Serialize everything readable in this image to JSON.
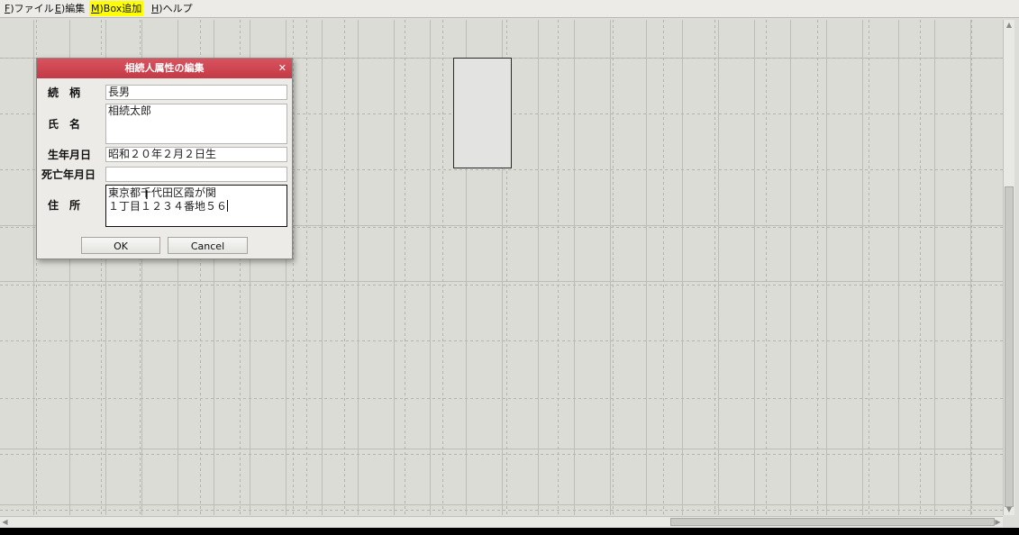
{
  "menu": [
    {
      "accel": "F",
      "label": ")ファイル",
      "highlighted": false
    },
    {
      "accel": "E",
      "label": ")編集",
      "highlighted": false
    },
    {
      "accel": "M",
      "label": ")Box追加",
      "highlighted": true
    },
    {
      "accel": "H",
      "label": ")ヘルプ",
      "highlighted": false
    }
  ],
  "dialog": {
    "title": "相続人属性の編集",
    "close_icon": "close-icon",
    "fields": {
      "relation_label": "続　柄",
      "relation_value": "長男",
      "name_label": "氏　名",
      "name_value": "相続太郎",
      "birth_label": "生年月日",
      "birth_value": "昭和２０年２月２日生",
      "death_label": "死亡年月日",
      "death_value": "",
      "address_label": "住　所",
      "address_value": "東京都千代田区霞が関\n１丁目１２３４番地５６"
    },
    "ok_label": "OK",
    "cancel_label": "Cancel"
  },
  "colors": {
    "titlebar": "#c9424f",
    "menu_highlight": "#ffff00"
  }
}
